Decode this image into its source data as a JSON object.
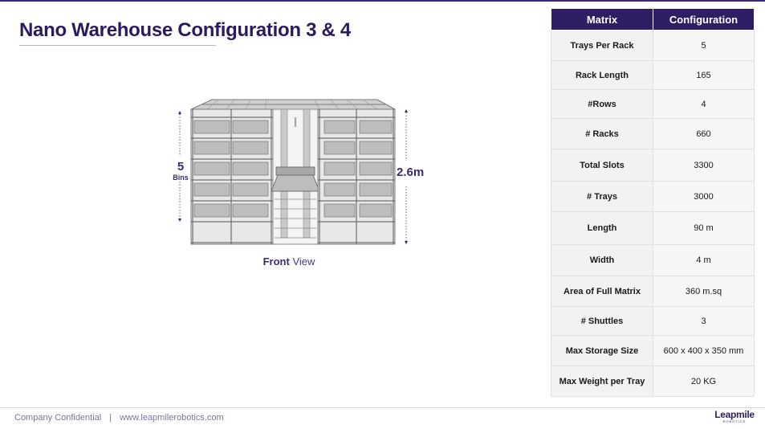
{
  "title": "Nano Warehouse Configuration 3 & 4",
  "figure": {
    "caption_bold": "Front",
    "caption_rest": " View",
    "height_label": "2.6m",
    "bins_count": "5",
    "bins_unit": "Bins"
  },
  "table": {
    "headers": [
      "Matrix",
      "Configuration"
    ],
    "rows": [
      {
        "key": "Trays Per Rack",
        "value": "5"
      },
      {
        "key": "Rack Length",
        "value": "165"
      },
      {
        "key": "#Rows",
        "value": "4"
      },
      {
        "key": "# Racks",
        "value": "660"
      },
      {
        "key": "Total Slots",
        "value": "3300"
      },
      {
        "key": "# Trays",
        "value": "3000"
      },
      {
        "key": "Length",
        "value": "90 m"
      },
      {
        "key": "Width",
        "value": "4 m"
      },
      {
        "key": "Area of Full Matrix",
        "value": "360  m.sq"
      },
      {
        "key": "# Shuttles",
        "value": "3"
      },
      {
        "key": "Max Storage Size",
        "value": "600 x 400 x 350 mm"
      },
      {
        "key": "Max Weight per Tray",
        "value": "20 KG"
      }
    ]
  },
  "footer": {
    "confidential": "Company Confidential",
    "separator": "|",
    "website": "www.leapmilerobotics.com"
  },
  "logo": {
    "name": "Leapmile",
    "tagline": "ROBOTICS"
  }
}
